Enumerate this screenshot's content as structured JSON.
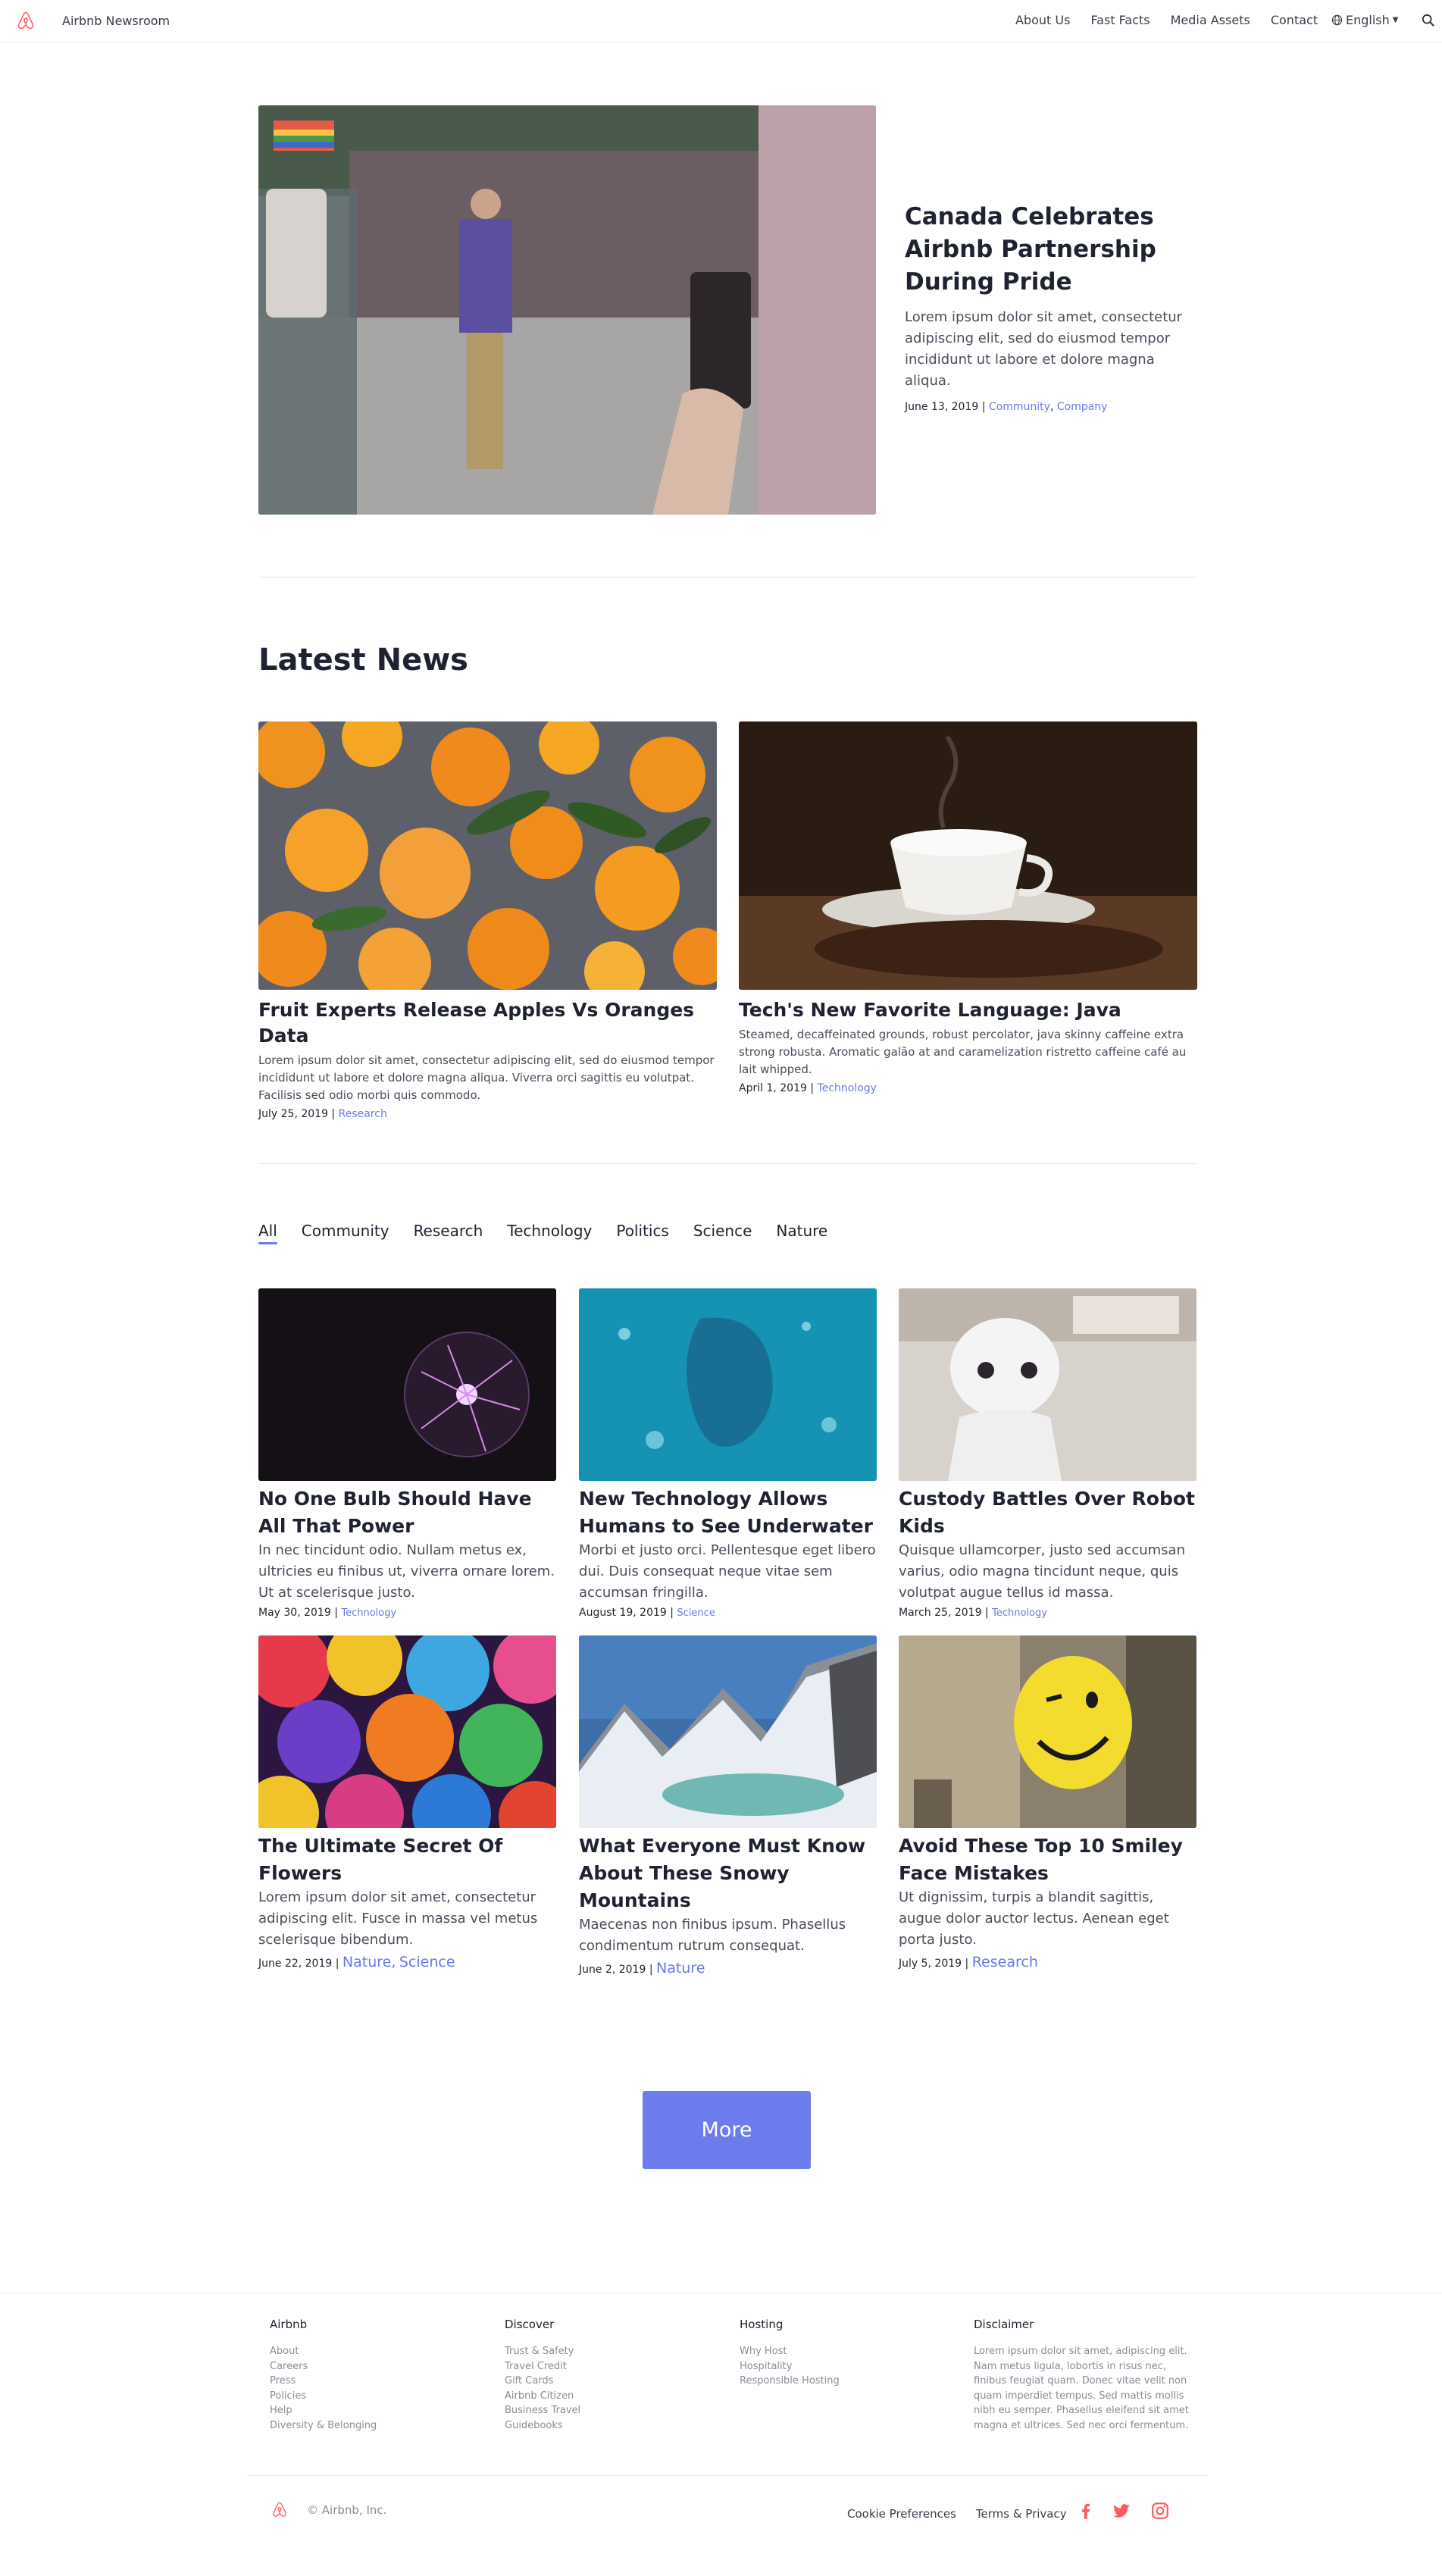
{
  "colors": {
    "accent": "#6a79e8",
    "brand": "#ff5a5f",
    "button": "#6d7ced"
  },
  "nav": {
    "brand": "Airbnb Newsroom",
    "links": [
      "About Us",
      "Fast Facts",
      "Media Assets",
      "Contact"
    ],
    "language": "English"
  },
  "hero": {
    "title": "Canada Celebrates Airbnb Partnership During Pride",
    "excerpt": "Lorem ipsum dolor sit amet, consectetur adipiscing elit, sed do eiusmod tempor incididunt ut labore et dolore magna aliqua.",
    "date": "June 13, 2019",
    "tags": [
      "Community",
      "Company"
    ]
  },
  "latest": {
    "heading": "Latest News",
    "items": [
      {
        "title": "Fruit Experts Release Apples Vs Oranges Data",
        "excerpt": "Lorem ipsum dolor sit amet, consectetur adipiscing elit, sed do eiusmod tempor incididunt ut labore et dolore magna aliqua. Viverra orci sagittis eu volutpat. Facilisis sed odio morbi quis commodo.",
        "date": "July 25, 2019",
        "tag": "Research"
      },
      {
        "title": "Tech's New Favorite Language: Java",
        "excerpt": "Steamed, decaffeinated grounds, robust percolator, java skinny caffeine extra strong robusta. Aromatic galão at and caramelization ristretto caffeine café au lait whipped.",
        "date": "April 1, 2019",
        "tag": "Technology"
      }
    ]
  },
  "filters": [
    "All",
    "Community",
    "Research",
    "Technology",
    "Politics",
    "Science",
    "Nature"
  ],
  "grid": [
    {
      "title": "No One Bulb Should Have All That Power",
      "excerpt": "In nec tincidunt odio. Nullam metus ex, ultricies eu finibus ut, viverra ornare lorem. Ut at scelerisque justo.",
      "date": "May 30, 2019",
      "tags": [
        "Technology"
      ]
    },
    {
      "title": "New Technology Allows Humans to See Underwater",
      "excerpt": "Morbi et justo orci. Pellentesque eget libero dui. Duis consequat neque vitae sem accumsan fringilla.",
      "date": "August 19, 2019",
      "tags": [
        "Science"
      ]
    },
    {
      "title": "Custody Battles Over Robot Kids",
      "excerpt": "Quisque ullamcorper, justo sed accumsan varius, odio magna tincidunt neque, quis volutpat augue tellus id massa.",
      "date": "March 25, 2019",
      "tags": [
        "Technology"
      ]
    },
    {
      "title": "The Ultimate Secret Of Flowers",
      "excerpt": "Lorem ipsum dolor sit amet, consectetur adipiscing elit. Fusce in massa vel metus scelerisque bibendum.",
      "date": "June 22, 2019",
      "tags": [
        "Nature",
        "Science"
      ]
    },
    {
      "title": "What Everyone Must Know About These Snowy Mountains",
      "excerpt": "Maecenas non finibus ipsum. Phasellus condimentum rutrum consequat.",
      "date": "June 2, 2019",
      "tags": [
        "Nature"
      ]
    },
    {
      "title": "Avoid These Top 10 Smiley Face Mistakes",
      "excerpt": "Ut dignissim, turpis a blandit sagittis, augue dolor auctor lectus. Aenean eget porta justo.",
      "date": "July 5, 2019",
      "tags": [
        "Research"
      ]
    }
  ],
  "more_label": "More",
  "footer": {
    "columns": [
      {
        "title": "Airbnb",
        "links": [
          "About",
          "Careers",
          "Press",
          "Policies",
          "Help",
          "Diversity & Belonging"
        ]
      },
      {
        "title": "Discover",
        "links": [
          "Trust & Safety",
          "Travel Credit",
          "Gift Cards",
          "Airbnb Citizen",
          "Business Travel",
          "Guidebooks"
        ]
      },
      {
        "title": "Hosting",
        "links": [
          "Why Host",
          "Hospitality",
          "Responsible Hosting"
        ]
      }
    ],
    "disclaimer": {
      "title": "Disclaimer",
      "text": "Lorem ipsum dolor sit amet, adipiscing elit. Nam metus ligula, lobortis in risus nec, finibus feugiat quam. Donec vitae velit non quam imperdiet tempus. Sed mattis mollis nibh eu semper. Phasellus eleifend sit amet magna et ultrices. Sed nec orci fermentum."
    },
    "copyright": "© Airbnb, Inc.",
    "links": [
      "Cookie Preferences",
      "Terms & Privacy"
    ],
    "social": [
      "facebook-icon",
      "twitter-icon",
      "instagram-icon"
    ]
  }
}
